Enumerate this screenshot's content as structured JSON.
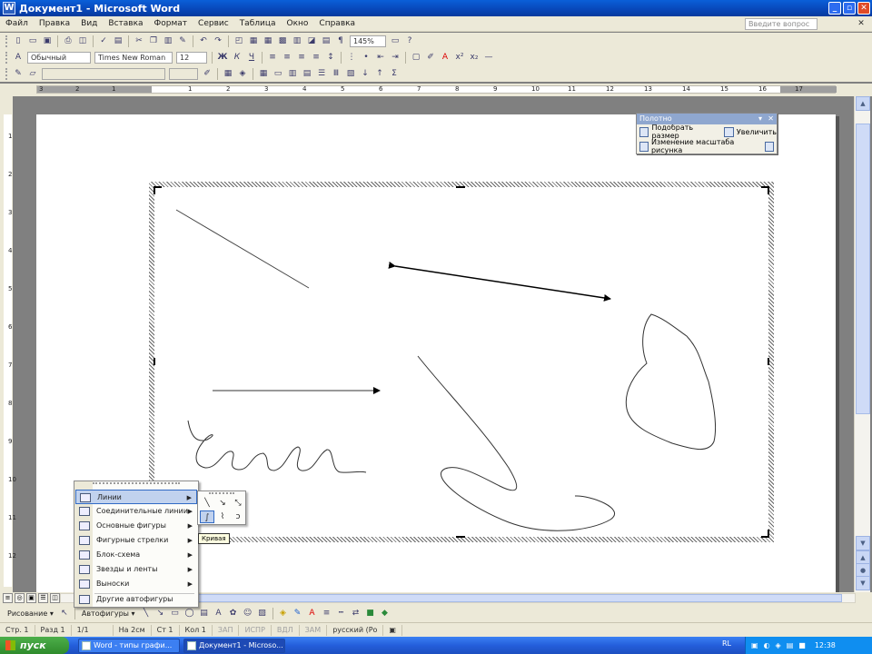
{
  "window": {
    "title": "Документ1 - Microsoft Word",
    "buttons": [
      "_",
      "▫",
      "✕"
    ]
  },
  "menubar": {
    "items": [
      "Файл",
      "Правка",
      "Вид",
      "Вставка",
      "Формат",
      "Сервис",
      "Таблица",
      "Окно",
      "Справка"
    ],
    "help_placeholder": "Введите вопрос",
    "close_doc": "✕"
  },
  "toolbar_standard": {
    "zoom": "145%",
    "paragraph_mark": "¶"
  },
  "toolbar_formatting": {
    "style": "Обычный",
    "font": "Times New Roman",
    "size": "12",
    "bold": "Ж",
    "italic": "К",
    "underline": "Ч"
  },
  "ruler": {
    "numbers": [
      "3",
      "2",
      "1",
      "1",
      "2",
      "3",
      "4",
      "5",
      "6",
      "7",
      "8",
      "9",
      "10",
      "11",
      "12",
      "13",
      "14",
      "15",
      "16",
      "17"
    ]
  },
  "vruler": {
    "numbers": [
      "1",
      "2",
      "3",
      "4",
      "5",
      "6",
      "7",
      "8",
      "9",
      "10",
      "11",
      "12"
    ]
  },
  "canvas_toolbar": {
    "title": "Полотно",
    "fit": "Подобрать размер",
    "expand": "Увеличить",
    "scale": "Изменение масштаба рисунка"
  },
  "autoshapes_menu": {
    "items": [
      {
        "label": "Линии"
      },
      {
        "label": "Соединительные линии"
      },
      {
        "label": "Основные фигуры"
      },
      {
        "label": "Фигурные стрелки"
      },
      {
        "label": "Блок-схема"
      },
      {
        "label": "Звезды и ленты"
      },
      {
        "label": "Выноски"
      },
      {
        "label": "Другие автофигуры"
      }
    ]
  },
  "lines_submenu": {
    "tooltip": "Кривая"
  },
  "drawing_toolbar": {
    "draw": "Рисование ▾",
    "autoshapes": "Автофигуры ▾"
  },
  "statusbar": {
    "cells": [
      "Стр. 1",
      "Разд 1",
      "1/1",
      "На 2см",
      "Ст 1",
      "Кол 1",
      "ЗАП",
      "ИСПР",
      "ВДЛ",
      "ЗАМ",
      "русский (Ро"
    ]
  },
  "taskbar": {
    "start": "пуск",
    "tasks": [
      "Word - типы графи...",
      "Документ1 - Microso..."
    ],
    "lang": "RL",
    "clock": "12:38"
  }
}
